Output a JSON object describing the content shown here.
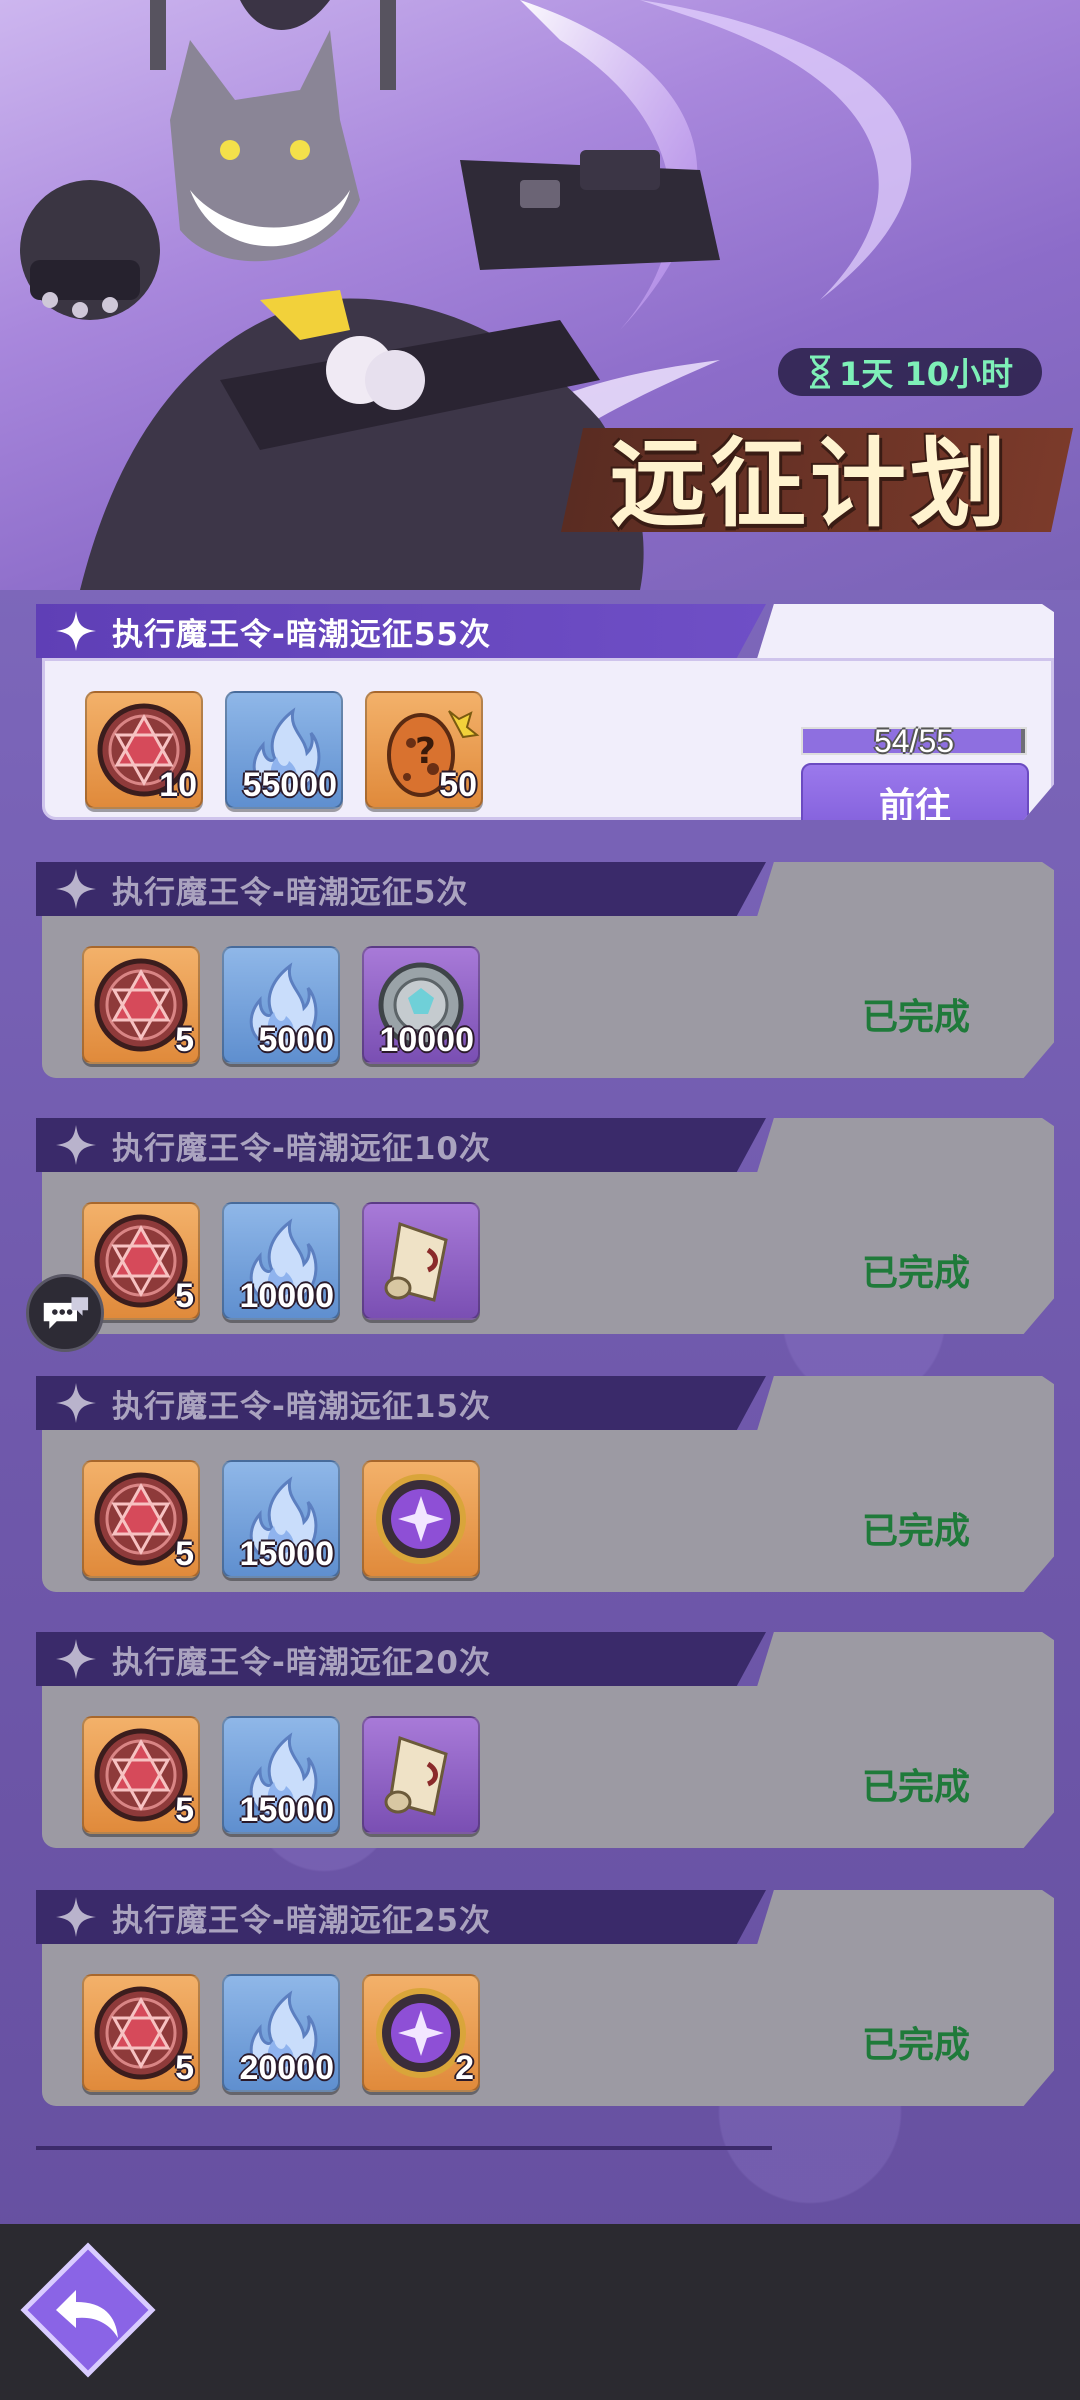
{
  "header": {
    "timer": "1天 10小时",
    "title": "远征计划"
  },
  "tasks": [
    {
      "label": "执行魔王令-暗潮远征55次",
      "state": "active",
      "progress_text": "54/55",
      "progress_value": 54,
      "progress_max": 55,
      "action_label": "前往",
      "rewards": [
        {
          "icon": "demon-seal-icon",
          "qty": "10",
          "bg": "orange"
        },
        {
          "icon": "blue-soulfire-icon",
          "qty": "55000",
          "bg": "blue"
        },
        {
          "icon": "mystery-egg-icon",
          "qty": "50",
          "bg": "orange"
        }
      ]
    },
    {
      "label": "执行魔王令-暗潮远征5次",
      "state": "done",
      "status": "已完成",
      "rewards": [
        {
          "icon": "demon-seal-icon",
          "qty": "5",
          "bg": "orange"
        },
        {
          "icon": "blue-soulfire-icon",
          "qty": "5000",
          "bg": "blue"
        },
        {
          "icon": "stone-coin-icon",
          "qty": "10000",
          "bg": "purple"
        }
      ]
    },
    {
      "label": "执行魔王令-暗潮远征10次",
      "state": "done",
      "status": "已完成",
      "rewards": [
        {
          "icon": "demon-seal-icon",
          "qty": "5",
          "bg": "orange"
        },
        {
          "icon": "blue-soulfire-icon",
          "qty": "10000",
          "bg": "blue"
        },
        {
          "icon": "scroll-icon",
          "qty": "",
          "bg": "purple"
        }
      ]
    },
    {
      "label": "执行魔王令-暗潮远征15次",
      "state": "done",
      "status": "已完成",
      "rewards": [
        {
          "icon": "demon-seal-icon",
          "qty": "5",
          "bg": "orange"
        },
        {
          "icon": "blue-soulfire-icon",
          "qty": "15000",
          "bg": "blue"
        },
        {
          "icon": "purple-orb-icon",
          "qty": "",
          "bg": "orange"
        }
      ]
    },
    {
      "label": "执行魔王令-暗潮远征20次",
      "state": "done",
      "status": "已完成",
      "rewards": [
        {
          "icon": "demon-seal-icon",
          "qty": "5",
          "bg": "orange"
        },
        {
          "icon": "blue-soulfire-icon",
          "qty": "15000",
          "bg": "blue"
        },
        {
          "icon": "scroll-icon",
          "qty": "",
          "bg": "purple"
        }
      ]
    },
    {
      "label": "执行魔王令-暗潮远征25次",
      "state": "done",
      "status": "已完成",
      "rewards": [
        {
          "icon": "demon-seal-icon",
          "qty": "5",
          "bg": "orange"
        },
        {
          "icon": "blue-soulfire-icon",
          "qty": "20000",
          "bg": "blue"
        },
        {
          "icon": "purple-orb-icon",
          "qty": "2",
          "bg": "orange"
        }
      ]
    }
  ],
  "colors": {
    "accent": "#7f5cd9",
    "done_text": "#1f7a3a",
    "timer_text": "#7ef0b8"
  }
}
